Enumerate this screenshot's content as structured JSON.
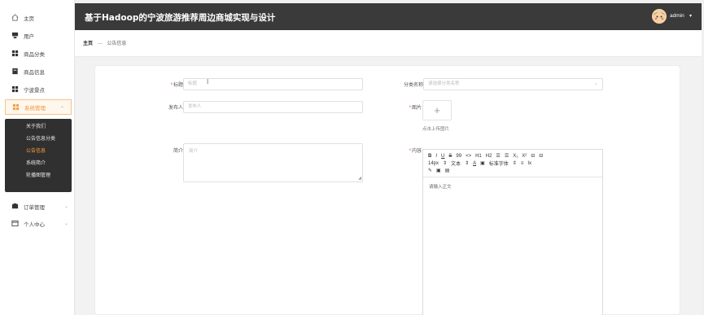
{
  "header": {
    "title": "基于Hadoop的宁波旅游推荐周边商城实现与设计",
    "user": "admin",
    "caret": "▾"
  },
  "sidebar": {
    "items": [
      {
        "label": "主页",
        "icon": "home-icon"
      },
      {
        "label": "用户",
        "icon": "user-icon"
      },
      {
        "label": "商品分类",
        "icon": "grid-icon"
      },
      {
        "label": "商品信息",
        "icon": "box-icon"
      },
      {
        "label": "宁波景点",
        "icon": "grid-icon"
      },
      {
        "label": "系统管理",
        "icon": "grid-icon"
      }
    ],
    "sub_items": [
      {
        "label": "关于我们"
      },
      {
        "label": "公告信息分类"
      },
      {
        "label": "公告信息"
      },
      {
        "label": "系统简介"
      },
      {
        "label": "轮播图管理"
      }
    ],
    "bottom_items": [
      {
        "label": "订单管理",
        "icon": "box-icon"
      },
      {
        "label": "个人中心",
        "icon": "window-icon"
      }
    ]
  },
  "breadcrumb": {
    "home": "主页",
    "sep": "—",
    "current": "公告信息"
  },
  "form": {
    "title_label": "标题",
    "title_placeholder": "标题",
    "category_label": "分类名称",
    "category_placeholder": "请选择分类名称",
    "publisher_label": "发布人",
    "publisher_placeholder": "发布人",
    "image_label": "图片",
    "upload_plus": "+",
    "upload_hint": "点击上传图片",
    "intro_label": "简介",
    "intro_placeholder": "简介",
    "content_label": "内容",
    "required_mark": "*",
    "editor_placeholder": "请输入正文"
  },
  "editor_toolbar": {
    "row1": [
      "B",
      "I",
      "U",
      "S",
      "99",
      "<>",
      "H1",
      "H2",
      "☰",
      "☰",
      "X₁",
      "X²",
      "⊟",
      "⊟"
    ],
    "row2": [
      "14px",
      "⇕",
      "文本",
      "⇕",
      "A",
      "▣",
      "标准字体",
      "⇕",
      "≡",
      "Ix"
    ],
    "row3": [
      "✎",
      "▣",
      "▤"
    ]
  }
}
